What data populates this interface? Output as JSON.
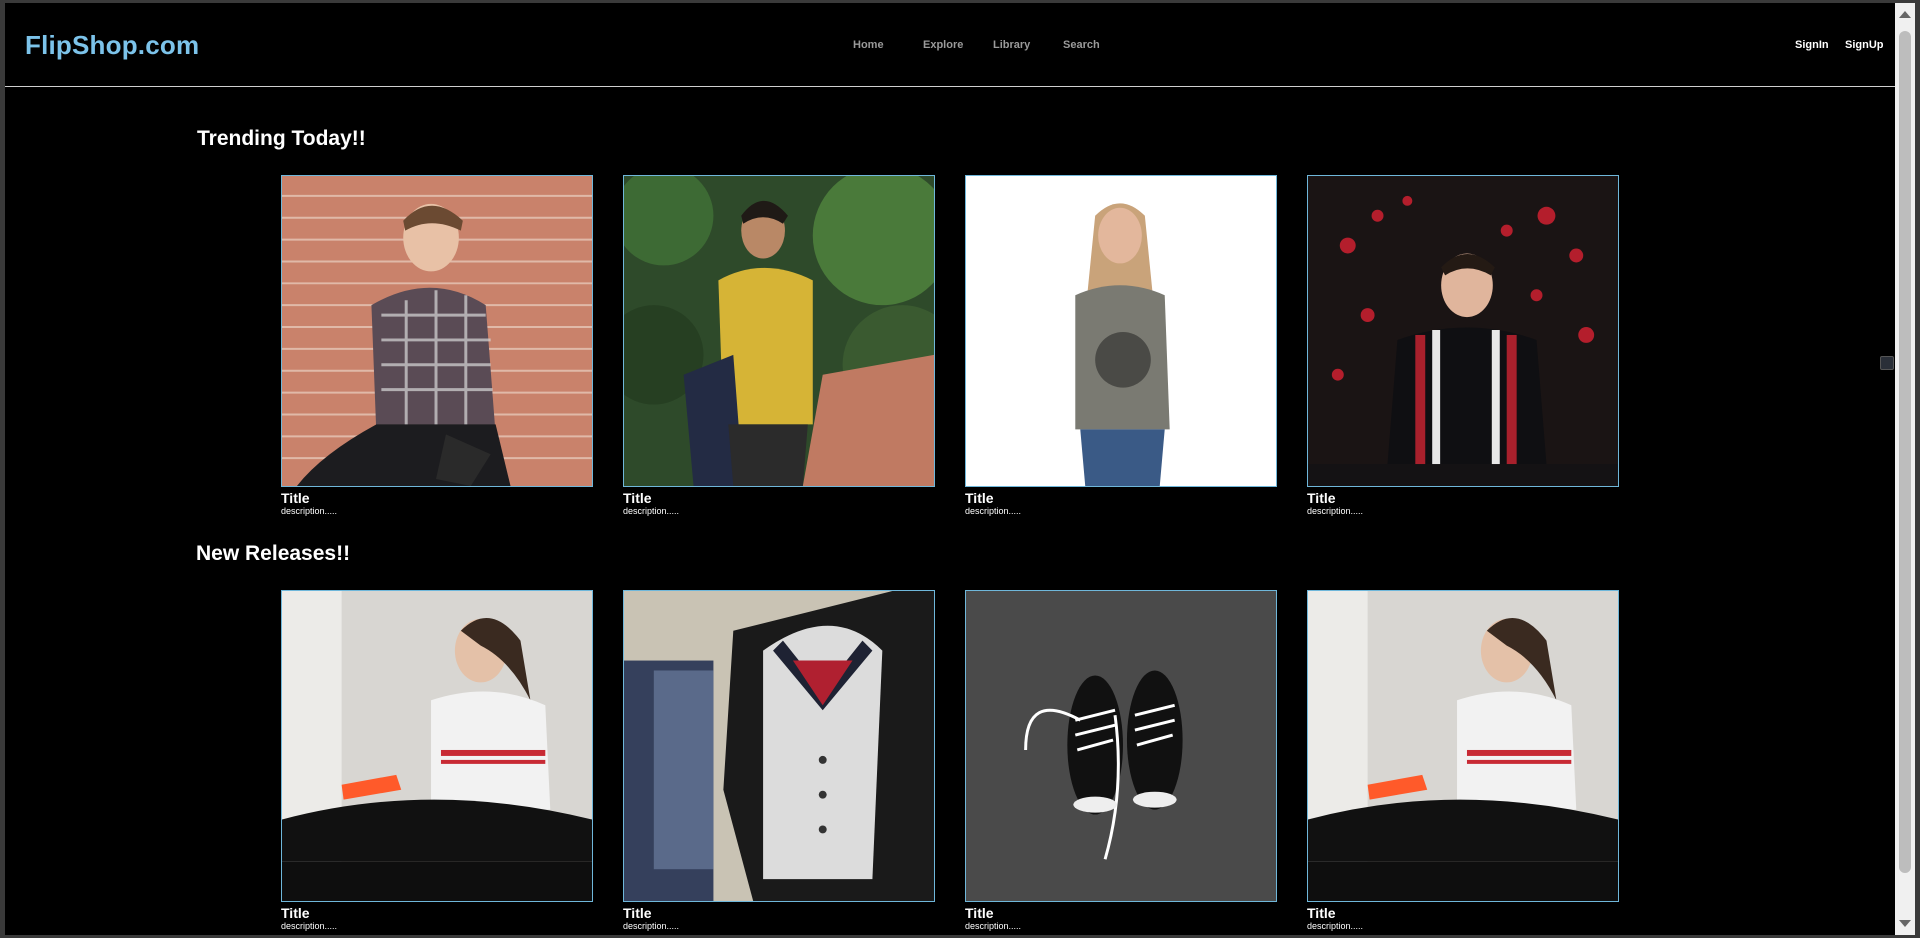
{
  "header": {
    "logo": "FlipShop.com",
    "nav": [
      {
        "label": "Home"
      },
      {
        "label": "Explore"
      },
      {
        "label": "Library"
      },
      {
        "label": "Search"
      }
    ],
    "signin": "SignIn",
    "signup": "SignUp"
  },
  "sections": [
    {
      "title": "Trending Today!!",
      "cards": [
        {
          "title": "Title",
          "description": "description....."
        },
        {
          "title": "Title",
          "description": "description....."
        },
        {
          "title": "Title",
          "description": "description....."
        },
        {
          "title": "Title",
          "description": "description....."
        }
      ]
    },
    {
      "title": "New Releases!!",
      "cards": [
        {
          "title": "Title",
          "description": "description....."
        },
        {
          "title": "Title",
          "description": "description....."
        },
        {
          "title": "Title",
          "description": "description....."
        },
        {
          "title": "Title",
          "description": "description....."
        }
      ]
    }
  ],
  "colors": {
    "background": "#000000",
    "logo": "#7cc3ea",
    "card_border": "#6fb7da",
    "nav_text": "#9a9a9a"
  }
}
